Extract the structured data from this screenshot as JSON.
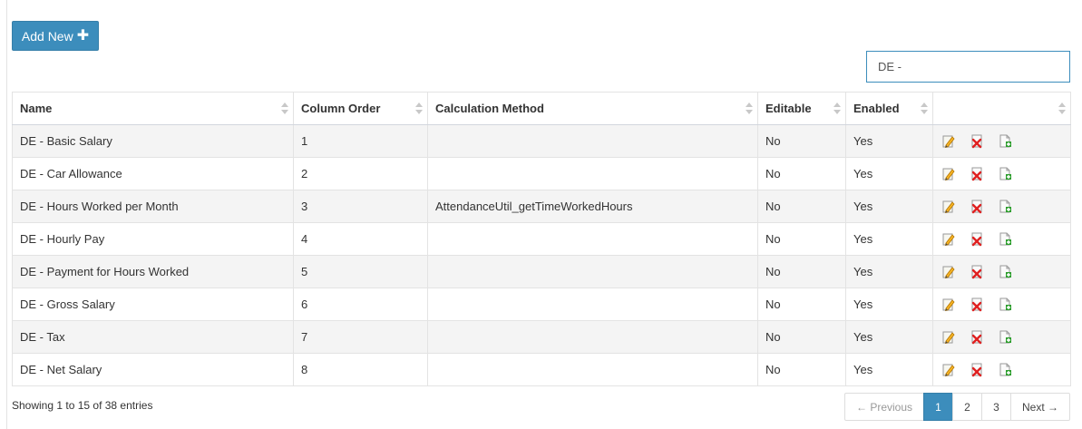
{
  "toolbar": {
    "add_label": "Add New",
    "add_icon": "plus-icon"
  },
  "search": {
    "value": "DE -",
    "placeholder": ""
  },
  "table": {
    "headers": [
      "Name",
      "Column Order",
      "Calculation Method",
      "Editable",
      "Enabled",
      ""
    ],
    "rows": [
      {
        "name": "DE - Basic Salary",
        "order": "1",
        "method": "",
        "editable": "No",
        "enabled": "Yes"
      },
      {
        "name": "DE - Car Allowance",
        "order": "2",
        "method": "",
        "editable": "No",
        "enabled": "Yes"
      },
      {
        "name": "DE - Hours Worked per Month",
        "order": "3",
        "method": "AttendanceUtil_getTimeWorkedHours",
        "editable": "No",
        "enabled": "Yes"
      },
      {
        "name": "DE - Hourly Pay",
        "order": "4",
        "method": "",
        "editable": "No",
        "enabled": "Yes"
      },
      {
        "name": "DE - Payment for Hours Worked",
        "order": "5",
        "method": "",
        "editable": "No",
        "enabled": "Yes"
      },
      {
        "name": "DE - Gross Salary",
        "order": "6",
        "method": "",
        "editable": "No",
        "enabled": "Yes"
      },
      {
        "name": "DE - Tax",
        "order": "7",
        "method": "",
        "editable": "No",
        "enabled": "Yes"
      },
      {
        "name": "DE - Net Salary",
        "order": "8",
        "method": "",
        "editable": "No",
        "enabled": "Yes"
      }
    ],
    "row_action_icons": [
      "edit-icon",
      "delete-icon",
      "copy-icon"
    ]
  },
  "footer": {
    "info": "Showing 1 to 15 of 38 entries"
  },
  "pagination": {
    "previous": "← Previous",
    "pages": [
      "1",
      "2",
      "3"
    ],
    "current": "1",
    "next": "Next →"
  },
  "colors": {
    "primary": "#3c8dbc",
    "striped_row": "#f4f4f4",
    "delete_red": "#e02020",
    "copy_green": "#2e9e2e"
  }
}
